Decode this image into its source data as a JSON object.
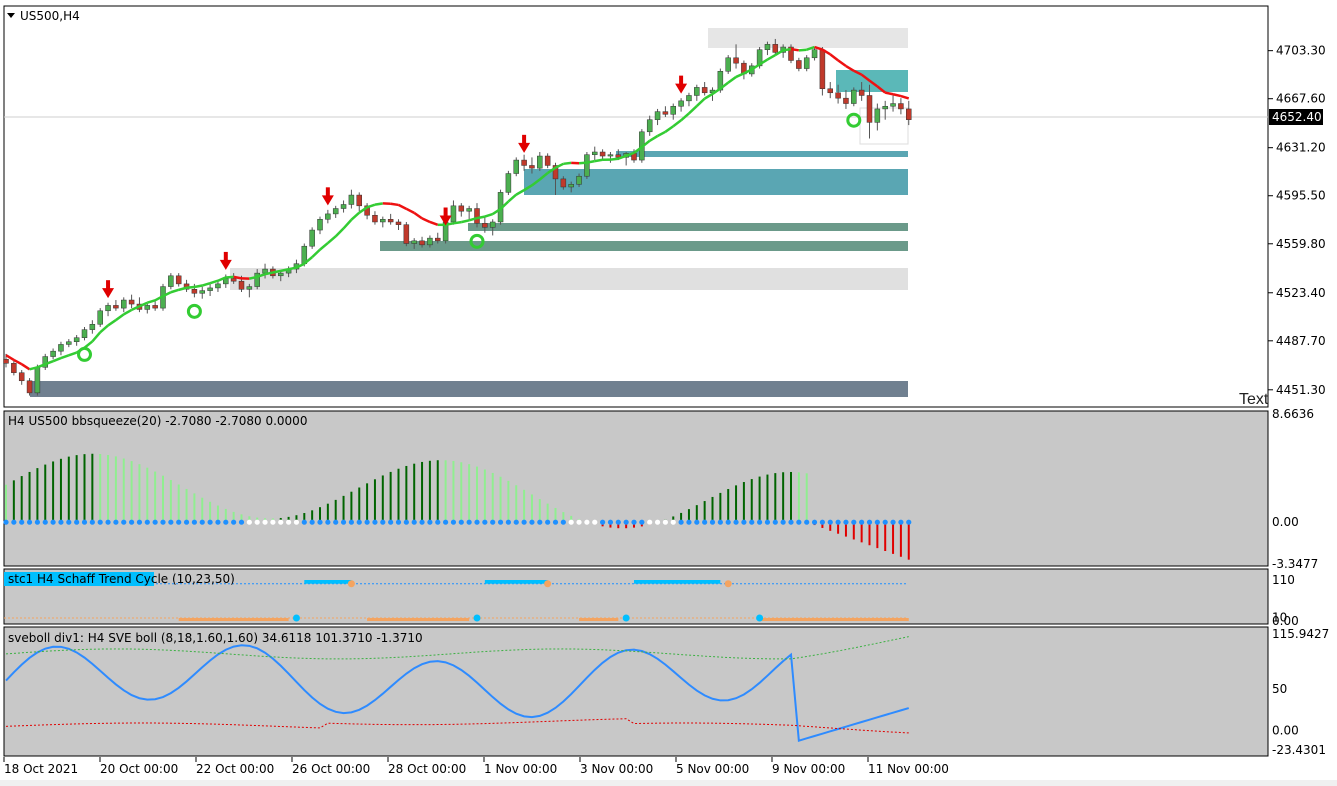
{
  "chart_data": {
    "type": "candlestick",
    "symbol_label": "US500,H4",
    "watermark": "Text",
    "price_axis": {
      "ticks": [
        "4703.30",
        "4667.60",
        "4631.20",
        "4595.50",
        "4559.80",
        "4523.40",
        "4487.70",
        "4451.30"
      ],
      "current_price": "4652.40",
      "range": [
        4440,
        4735
      ]
    },
    "time_axis": {
      "labels": [
        "18 Oct 2021",
        "20 Oct 00:00",
        "22 Oct 00:00",
        "26 Oct 00:00",
        "28 Oct 00:00",
        "1 Nov 00:00",
        "3 Nov 00:00",
        "5 Nov 00:00",
        "9 Nov 00:00",
        "11 Nov 00:00"
      ]
    },
    "candles": [
      [
        4474,
        4478,
        4468,
        4471
      ],
      [
        4471,
        4473,
        4462,
        4464
      ],
      [
        4464,
        4466,
        4455,
        4458
      ],
      [
        4458,
        4460,
        4447,
        4449
      ],
      [
        4449,
        4470,
        4447,
        4468
      ],
      [
        4468,
        4478,
        4466,
        4476
      ],
      [
        4476,
        4482,
        4474,
        4480
      ],
      [
        4480,
        4487,
        4477,
        4485
      ],
      [
        4485,
        4489,
        4483,
        4487
      ],
      [
        4487,
        4492,
        4484,
        4490
      ],
      [
        4490,
        4498,
        4488,
        4496
      ],
      [
        4496,
        4503,
        4493,
        4500
      ],
      [
        4500,
        4512,
        4498,
        4510
      ],
      [
        4510,
        4516,
        4506,
        4514
      ],
      [
        4514,
        4518,
        4510,
        4512
      ],
      [
        4512,
        4520,
        4509,
        4518
      ],
      [
        4518,
        4522,
        4512,
        4515
      ],
      [
        4515,
        4520,
        4509,
        4511
      ],
      [
        4511,
        4516,
        4508,
        4514
      ],
      [
        4514,
        4518,
        4510,
        4512
      ],
      [
        4512,
        4530,
        4510,
        4528
      ],
      [
        4528,
        4538,
        4526,
        4536
      ],
      [
        4536,
        4538,
        4528,
        4530
      ],
      [
        4530,
        4533,
        4524,
        4526
      ],
      [
        4526,
        4530,
        4520,
        4523
      ],
      [
        4523,
        4528,
        4519,
        4525
      ],
      [
        4525,
        4530,
        4521,
        4527
      ],
      [
        4527,
        4533,
        4524,
        4530
      ],
      [
        4530,
        4537,
        4527,
        4534
      ],
      [
        4534,
        4538,
        4530,
        4532
      ],
      [
        4532,
        4536,
        4524,
        4526
      ],
      [
        4526,
        4530,
        4520,
        4528
      ],
      [
        4528,
        4541,
        4526,
        4538
      ],
      [
        4538,
        4545,
        4534,
        4541
      ],
      [
        4541,
        4543,
        4534,
        4536
      ],
      [
        4536,
        4540,
        4532,
        4538
      ],
      [
        4538,
        4543,
        4535,
        4541
      ],
      [
        4541,
        4548,
        4538,
        4545
      ],
      [
        4545,
        4560,
        4543,
        4558
      ],
      [
        4558,
        4572,
        4556,
        4570
      ],
      [
        4570,
        4580,
        4567,
        4578
      ],
      [
        4578,
        4585,
        4575,
        4582
      ],
      [
        4582,
        4588,
        4579,
        4586
      ],
      [
        4586,
        4592,
        4583,
        4589
      ],
      [
        4589,
        4600,
        4586,
        4596
      ],
      [
        4596,
        4598,
        4584,
        4588
      ],
      [
        4588,
        4590,
        4578,
        4581
      ],
      [
        4581,
        4584,
        4574,
        4576
      ],
      [
        4576,
        4580,
        4572,
        4578
      ],
      [
        4578,
        4582,
        4574,
        4576
      ],
      [
        4576,
        4578,
        4570,
        4574
      ],
      [
        4574,
        4576,
        4558,
        4560
      ],
      [
        4560,
        4564,
        4556,
        4562
      ],
      [
        4562,
        4565,
        4557,
        4559
      ],
      [
        4559,
        4566,
        4557,
        4564
      ],
      [
        4564,
        4568,
        4560,
        4562
      ],
      [
        4562,
        4578,
        4560,
        4576
      ],
      [
        4576,
        4592,
        4574,
        4588
      ],
      [
        4588,
        4590,
        4580,
        4584
      ],
      [
        4584,
        4588,
        4578,
        4586
      ],
      [
        4586,
        4590,
        4572,
        4575
      ],
      [
        4575,
        4580,
        4568,
        4572
      ],
      [
        4572,
        4578,
        4566,
        4576
      ],
      [
        4576,
        4600,
        4574,
        4598
      ],
      [
        4598,
        4614,
        4596,
        4612
      ],
      [
        4612,
        4624,
        4610,
        4622
      ],
      [
        4622,
        4626,
        4614,
        4618
      ],
      [
        4618,
        4624,
        4612,
        4616
      ],
      [
        4616,
        4628,
        4614,
        4625
      ],
      [
        4625,
        4627,
        4616,
        4618
      ],
      [
        4618,
        4620,
        4596,
        4608
      ],
      [
        4608,
        4610,
        4600,
        4602
      ],
      [
        4602,
        4606,
        4598,
        4604
      ],
      [
        4604,
        4612,
        4602,
        4610
      ],
      [
        4610,
        4628,
        4608,
        4626
      ],
      [
        4626,
        4632,
        4622,
        4628
      ],
      [
        4628,
        4630,
        4622,
        4625
      ],
      [
        4625,
        4628,
        4620,
        4626
      ],
      [
        4626,
        4630,
        4622,
        4624
      ],
      [
        4624,
        4628,
        4618,
        4627
      ],
      [
        4627,
        4630,
        4620,
        4622
      ],
      [
        4622,
        4645,
        4620,
        4643
      ],
      [
        4643,
        4655,
        4640,
        4652
      ],
      [
        4652,
        4660,
        4648,
        4658
      ],
      [
        4658,
        4662,
        4654,
        4656
      ],
      [
        4656,
        4664,
        4652,
        4662
      ],
      [
        4662,
        4668,
        4658,
        4666
      ],
      [
        4666,
        4672,
        4662,
        4670
      ],
      [
        4670,
        4678,
        4666,
        4676
      ],
      [
        4676,
        4680,
        4670,
        4672
      ],
      [
        4672,
        4676,
        4666,
        4674
      ],
      [
        4674,
        4690,
        4672,
        4688
      ],
      [
        4688,
        4700,
        4686,
        4698
      ],
      [
        4698,
        4708,
        4690,
        4694
      ],
      [
        4694,
        4696,
        4682,
        4686
      ],
      [
        4686,
        4694,
        4684,
        4692
      ],
      [
        4692,
        4706,
        4690,
        4704
      ],
      [
        4704,
        4710,
        4700,
        4708
      ],
      [
        4708,
        4712,
        4700,
        4702
      ],
      [
        4702,
        4708,
        4698,
        4706
      ],
      [
        4706,
        4708,
        4694,
        4696
      ],
      [
        4696,
        4698,
        4688,
        4690
      ],
      [
        4690,
        4700,
        4688,
        4698
      ],
      [
        4698,
        4706,
        4696,
        4704
      ],
      [
        4704,
        4706,
        4670,
        4675
      ],
      [
        4675,
        4680,
        4668,
        4672
      ],
      [
        4672,
        4678,
        4664,
        4668
      ],
      [
        4668,
        4674,
        4660,
        4664
      ],
      [
        4664,
        4676,
        4662,
        4674
      ],
      [
        4674,
        4680,
        4666,
        4670
      ],
      [
        4670,
        4678,
        4638,
        4650
      ],
      [
        4650,
        4664,
        4644,
        4660
      ],
      [
        4660,
        4666,
        4652,
        4662
      ],
      [
        4662,
        4670,
        4658,
        4664
      ],
      [
        4664,
        4668,
        4656,
        4660
      ],
      [
        4660,
        4666,
        4648,
        4652
      ]
    ],
    "indicators": [
      {
        "label": "H4 US500 bbsqueeze(20) -2.7080 -2.7080 0.0000",
        "ticks": [
          "8.6636",
          "0.00",
          "-3.3477"
        ],
        "range": [
          -3.3477,
          8.6636
        ]
      },
      {
        "label": "stc1 H4 Schaff Trend Cycle (10,23,50)",
        "ticks": [
          "110",
          "10",
          "0.00"
        ],
        "range": [
          0,
          110
        ]
      },
      {
        "label": "sveboll div1: H4 SVE boll (8,18,1.60,1.60) 34.6118 101.3710 -1.3710",
        "ticks": [
          "115.9427",
          "50",
          "0.00",
          "-23.4301"
        ],
        "range": [
          -23.4301,
          115.9427
        ]
      }
    ],
    "colors": {
      "up": "#4caf50",
      "down": "#c0392b",
      "trend_up": "#33cc33",
      "trend_down": "#ee1111",
      "teal": "#3d9aaa",
      "squeeze_dark": "#006400",
      "squeeze_light": "#90ee90",
      "stc_blue": "#00bfff",
      "stc_orange": "#f4a460",
      "sve_blue": "#2e8bff"
    }
  }
}
